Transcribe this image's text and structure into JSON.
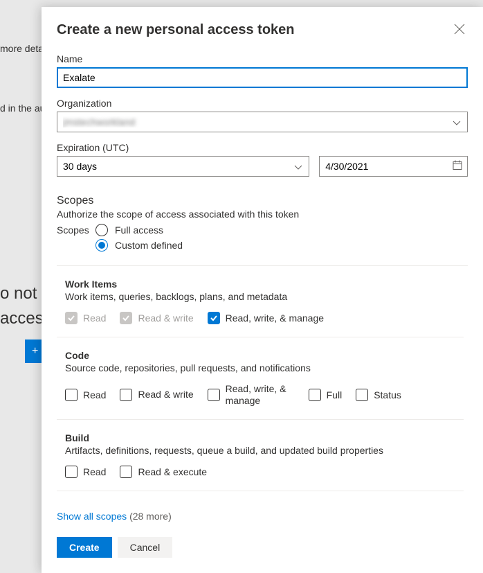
{
  "background": {
    "more_details": "more details",
    "in_aut": "d in the aut",
    "o_not": "o not",
    "access": "access",
    "plus": "+"
  },
  "panel": {
    "title": "Create a new personal access token"
  },
  "fields": {
    "name_label": "Name",
    "name_value": "Exalate",
    "org_label": "Organization",
    "org_value": "jmstechworkland",
    "expiration_label": "Expiration (UTC)",
    "expiration_value": "30 days",
    "date_value": "4/30/2021"
  },
  "scopes": {
    "heading": "Scopes",
    "subheading": "Authorize the scope of access associated with this token",
    "label": "Scopes",
    "full_access": "Full access",
    "custom_defined": "Custom defined"
  },
  "sections": {
    "work_items": {
      "title": "Work Items",
      "desc": "Work items, queries, backlogs, plans, and metadata",
      "opt_read": "Read",
      "opt_rw": "Read & write",
      "opt_rwm": "Read, write, & manage"
    },
    "code": {
      "title": "Code",
      "desc": "Source code, repositories, pull requests, and notifications",
      "opt_read": "Read",
      "opt_rw": "Read & write",
      "opt_rwm": "Read, write, & manage",
      "opt_full": "Full",
      "opt_status": "Status"
    },
    "build": {
      "title": "Build",
      "desc": "Artifacts, definitions, requests, queue a build, and updated build properties",
      "opt_read": "Read",
      "opt_rx": "Read & execute"
    }
  },
  "show_all": {
    "link": "Show all scopes",
    "count": "(28 more)"
  },
  "footer": {
    "create": "Create",
    "cancel": "Cancel"
  }
}
